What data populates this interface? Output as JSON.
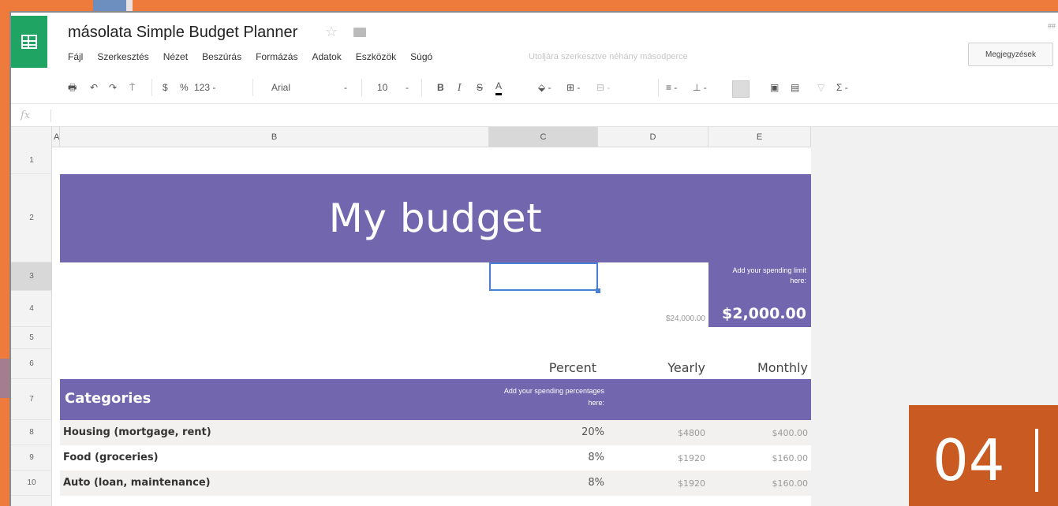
{
  "app": {
    "title": "másolata Simple Budget Planner",
    "menu": [
      "Fájl",
      "Szerkesztés",
      "Nézet",
      "Beszúrás",
      "Formázás",
      "Adatok",
      "Eszközök",
      "Súgó"
    ],
    "last_edit": "Utoljára szerkesztve néhány másodperce",
    "comments_button": "Megjegyzések",
    "top_right_hint": "##"
  },
  "toolbar": {
    "currency": "$",
    "percent": "%",
    "number_format": "123 -",
    "font_family": "Arial",
    "font_size": "10",
    "bold": "B",
    "italic": "I",
    "strike": "S",
    "text_color": "A",
    "sum": "Σ -"
  },
  "formula_bar": {
    "fx": "fx",
    "value": ""
  },
  "columns": [
    "A",
    "B",
    "C",
    "D",
    "E"
  ],
  "rows": [
    "1",
    "2",
    "3",
    "4",
    "5",
    "6",
    "7",
    "8",
    "9",
    "10"
  ],
  "sheet": {
    "title": "My budget",
    "limit_hint": "Add your spending limit here:",
    "limit_value": "$2,000.00",
    "yearly_total": "$24,000.00",
    "header_percent": "Percent",
    "header_yearly": "Yearly",
    "header_monthly": "Monthly",
    "categories_label": "Categories",
    "percent_hint": "Add your spending percentages here:",
    "items": [
      {
        "name": "Housing (mortgage, rent)",
        "percent": "20%",
        "yearly": "$4800",
        "monthly": "$400.00"
      },
      {
        "name": "Food (groceries)",
        "percent": "8%",
        "yearly": "$1920",
        "monthly": "$160.00"
      },
      {
        "name": "Auto (loan, maintenance)",
        "percent": "8%",
        "yearly": "$1920",
        "monthly": "$160.00"
      }
    ]
  },
  "badge": {
    "number": "04"
  },
  "colors": {
    "accent_purple": "#7266ae",
    "sheets_green": "#1fa463",
    "badge_orange": "#c85a22",
    "background_orange": "#ee7a3c"
  }
}
